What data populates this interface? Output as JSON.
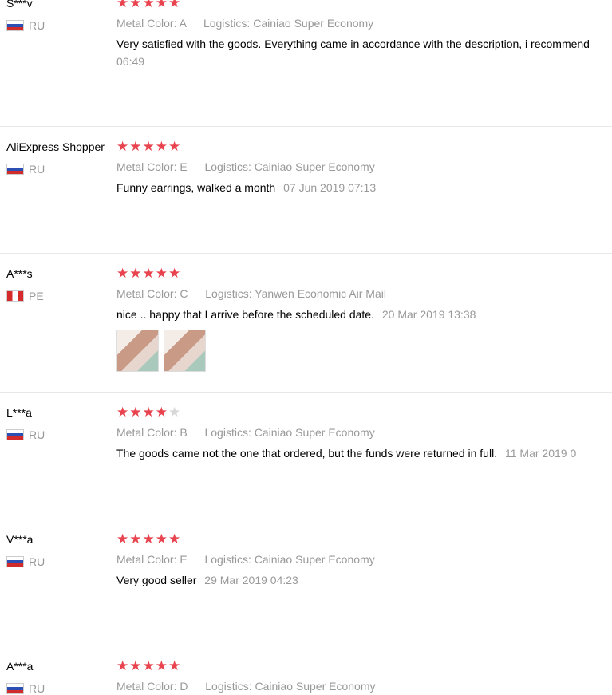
{
  "reviews": [
    {
      "user": "S***v",
      "country": "RU",
      "flag": "ru",
      "rating": 5,
      "metal_color_label": "Metal Color:",
      "metal_color": "A",
      "logistics_label": "Logistics:",
      "logistics": "Cainiao Super Economy",
      "text": "Very satisfied with the goods. Everything came in accordance with the description, i recommend",
      "date": "06:49"
    },
    {
      "user": "AliExpress Shopper",
      "country": "RU",
      "flag": "ru",
      "rating": 5,
      "metal_color_label": "Metal Color:",
      "metal_color": "E",
      "logistics_label": "Logistics:",
      "logistics": "Cainiao Super Economy",
      "text": "Funny earrings, walked a month",
      "date": "07 Jun 2019 07:13"
    },
    {
      "user": "A***s",
      "country": "PE",
      "flag": "pe",
      "rating": 5,
      "metal_color_label": "Metal Color:",
      "metal_color": "C",
      "logistics_label": "Logistics:",
      "logistics": "Yanwen Economic Air Mail",
      "text": "nice .. happy that I arrive before the scheduled date.",
      "date": "20 Mar 2019 13:38",
      "photos": 2
    },
    {
      "user": "L***a",
      "country": "RU",
      "flag": "ru",
      "rating": 4,
      "metal_color_label": "Metal Color:",
      "metal_color": "B",
      "logistics_label": "Logistics:",
      "logistics": "Cainiao Super Economy",
      "text": "The goods came not the one that ordered, but the funds were returned in full.",
      "date": "11 Mar 2019 0"
    },
    {
      "user": "V***a",
      "country": "RU",
      "flag": "ru",
      "rating": 5,
      "metal_color_label": "Metal Color:",
      "metal_color": "E",
      "logistics_label": "Logistics:",
      "logistics": "Cainiao Super Economy",
      "text": "Very good seller",
      "date": "29 Mar 2019 04:23"
    },
    {
      "user": "A***a",
      "country": "RU",
      "flag": "ru",
      "rating": 5,
      "metal_color_label": "Metal Color:",
      "metal_color": "D",
      "logistics_label": "Logistics:",
      "logistics": "Cainiao Super Economy"
    }
  ]
}
